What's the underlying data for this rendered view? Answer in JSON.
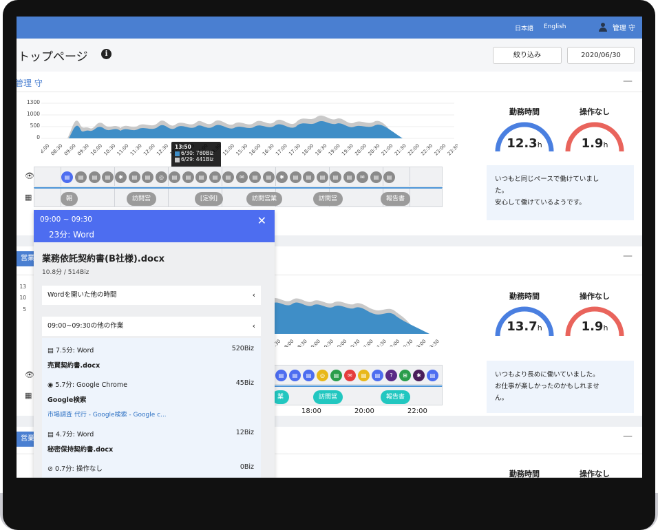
{
  "nav": {
    "lang_ja": "日本語",
    "lang_en": "English",
    "user_name": "管理 守"
  },
  "header": {
    "title": "トップページ",
    "filter_button": "絞り込み",
    "date_button": "2020/06/30"
  },
  "chart_axes": {
    "y_ticks": [
      "1300",
      "1000",
      "500",
      "0"
    ],
    "y_ticks_short": [
      "13",
      "10",
      "5"
    ],
    "x_ticks": [
      "08:00",
      "08:30",
      "09:00",
      "09:30",
      "10:00",
      "10:30",
      "11:00",
      "11:30",
      "12:00",
      "12:30",
      "13:00",
      "13:30",
      "14:00",
      "14:30",
      "15:00",
      "15:30",
      "16:00",
      "16:30",
      "17:00",
      "17:30",
      "18:00",
      "18:30",
      "19:00",
      "19:30",
      "20:00",
      "20:30",
      "21:00",
      "21:30",
      "22:00",
      "22:30",
      "23:00",
      "23:30"
    ],
    "x_ticks_card2": [
      "17:30",
      "18:00",
      "18:30",
      "19:00",
      "19:30",
      "20:00",
      "20:30",
      "21:00",
      "21:30",
      "22:00",
      "22:30",
      "23:00",
      "23:30"
    ]
  },
  "tooltip": {
    "time": "13:50",
    "line1": "6/30: 780Biz",
    "line2": "6/29: 441Biz"
  },
  "colors": {
    "nav": "#4a7fd1",
    "series_today": "#3f8ec7",
    "series_prev": "#c9c9c9",
    "work_ring": "#4a7fe0",
    "idle_ring": "#e9645c"
  },
  "cards": [
    {
      "name": "管理 守",
      "work_title": "勤務時間",
      "work_value": "12.3",
      "work_unit": "h",
      "idle_title": "操作なし",
      "idle_value": "1.9",
      "idle_unit": "h",
      "comment_lines": [
        "いつもと同じペースで働けていまし",
        "た。",
        "安心して働けているようです。"
      ],
      "pills": [
        "朝",
        "訪問営",
        "[定例]",
        "訪問営業",
        "訪問営",
        "報告書"
      ]
    },
    {
      "name": "営業",
      "work_title": "勤務時間",
      "work_value": "13.7",
      "work_unit": "h",
      "idle_title": "操作なし",
      "idle_value": "1.9",
      "idle_unit": "h",
      "comment_lines": [
        "いつもより長めに働いていました。",
        "お仕事が楽しかったのかもしれませ",
        "ん。"
      ],
      "pills": [
        "業",
        "訪問営",
        "報告書"
      ],
      "time_labels": [
        "18:00",
        "20:00",
        "22:00"
      ]
    },
    {
      "name": "営業",
      "work_title": "勤務時間",
      "idle_title": "操作なし"
    }
  ],
  "popup": {
    "range": "09:00 ~ 09:30",
    "app": "23分: Word",
    "file": "業務依託契約書(B社様).docx",
    "size": "10.8分 / 514Biz",
    "section1": "Wordを開いた他の時間",
    "section2": "09:00~09:30の他の作業",
    "activities": [
      {
        "head": "7.5分: Word",
        "biz": "520Biz",
        "doc": "売買契約書.docx",
        "link": ""
      },
      {
        "head": "5.7分: Google Chrome",
        "biz": "45Biz",
        "doc": "Google検索",
        "link": "市場調査 代行 - Google検索 - Google c..."
      },
      {
        "head": "4.7分: Word",
        "biz": "12Biz",
        "doc": "秘密保持契約書.docx",
        "link": ""
      },
      {
        "head": "0.7分: 操作なし",
        "biz": "0Biz",
        "doc": "",
        "link": ""
      }
    ]
  }
}
